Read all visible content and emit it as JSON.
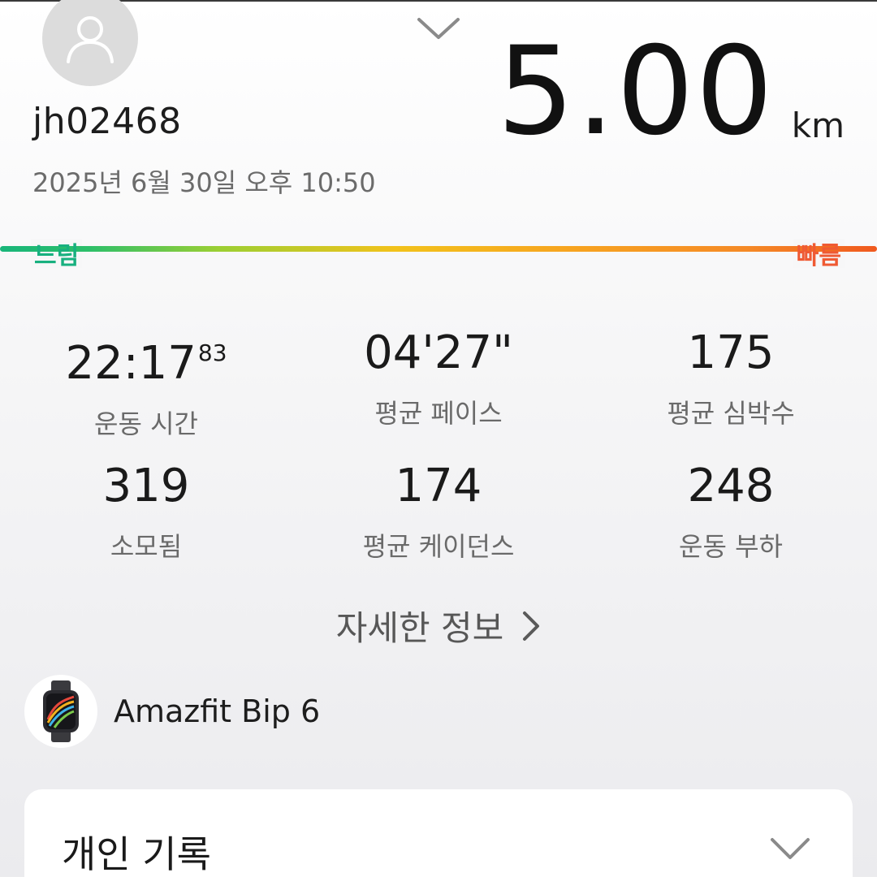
{
  "user": {
    "username": "jh02468",
    "datetime": "2025년 6월 30일 오후 10:50"
  },
  "workout": {
    "distance_value": "5.00",
    "distance_unit": "km"
  },
  "speed_scale": {
    "slow_label": "느림",
    "fast_label": "빠름"
  },
  "stats": [
    {
      "value": "22:17",
      "superscript": "83",
      "label": "운동 시간"
    },
    {
      "value": "04'27\"",
      "superscript": "",
      "label": "평균 페이스"
    },
    {
      "value": "175",
      "superscript": "",
      "label": "평균 심박수"
    },
    {
      "value": "319",
      "superscript": "",
      "label": "소모됨"
    },
    {
      "value": "174",
      "superscript": "",
      "label": "평균 케이던스"
    },
    {
      "value": "248",
      "superscript": "",
      "label": "운동 부하"
    }
  ],
  "details": {
    "label": "자세한 정보"
  },
  "device": {
    "name": "Amazfit Bip 6"
  },
  "records_card": {
    "title": "개인 기록"
  },
  "colors": {
    "slow": "#18b07f",
    "fast": "#ef5a33",
    "avatar_bg": "#dcdcdc"
  },
  "icons": {
    "avatar": "user-silhouette-icon",
    "collapse": "chevron-down-icon",
    "details": "chevron-right-icon",
    "device": "smartwatch-icon",
    "card": "chevron-down-icon"
  }
}
